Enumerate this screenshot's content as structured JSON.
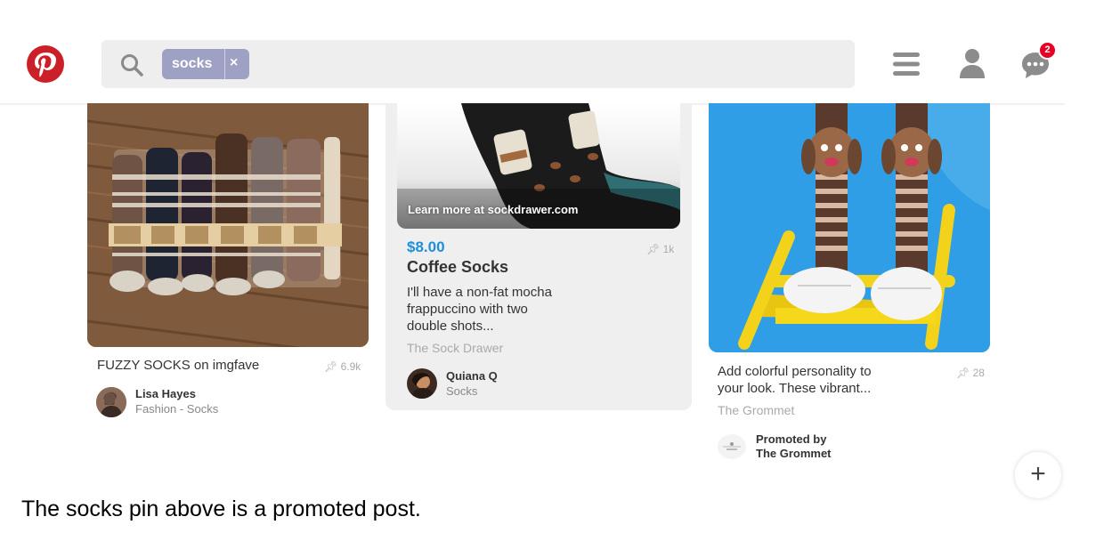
{
  "header": {
    "logo_icon": "pinterest-logo",
    "search_icon": "search-icon",
    "search_chip": {
      "label": "socks",
      "close_symbol": "×"
    },
    "menu_icon": "hamburger-menu-icon",
    "profile_icon": "user-icon",
    "messages_icon": "chat-bubble-icon",
    "messages_badge": "2",
    "brand_color": "#cb2027"
  },
  "pins": [
    {
      "description": "FUZZY SOCKS on imgfave",
      "saves": "6.9k",
      "user_name": "Lisa Hayes",
      "board": "Fashion - Socks"
    },
    {
      "overlay_link": "Learn more at sockdrawer.com",
      "price": "$8.00",
      "price_color": "#1e8fdc",
      "title": "Coffee Socks",
      "saves": "1k",
      "description_lines": [
        "I'll have a non-fat mocha",
        "frappuccino with two",
        "double shots..."
      ],
      "source": "The Sock Drawer",
      "user_name": "Quiana Q",
      "board": "Socks"
    },
    {
      "description_lines": [
        "Add colorful personality to",
        "your look. These vibrant..."
      ],
      "saves": "28",
      "source": "The Grommet",
      "promoted_line1": "Promoted by",
      "promoted_line2": "The Grommet"
    }
  ],
  "fab_label": "+",
  "caption": "The socks pin above is a promoted post."
}
